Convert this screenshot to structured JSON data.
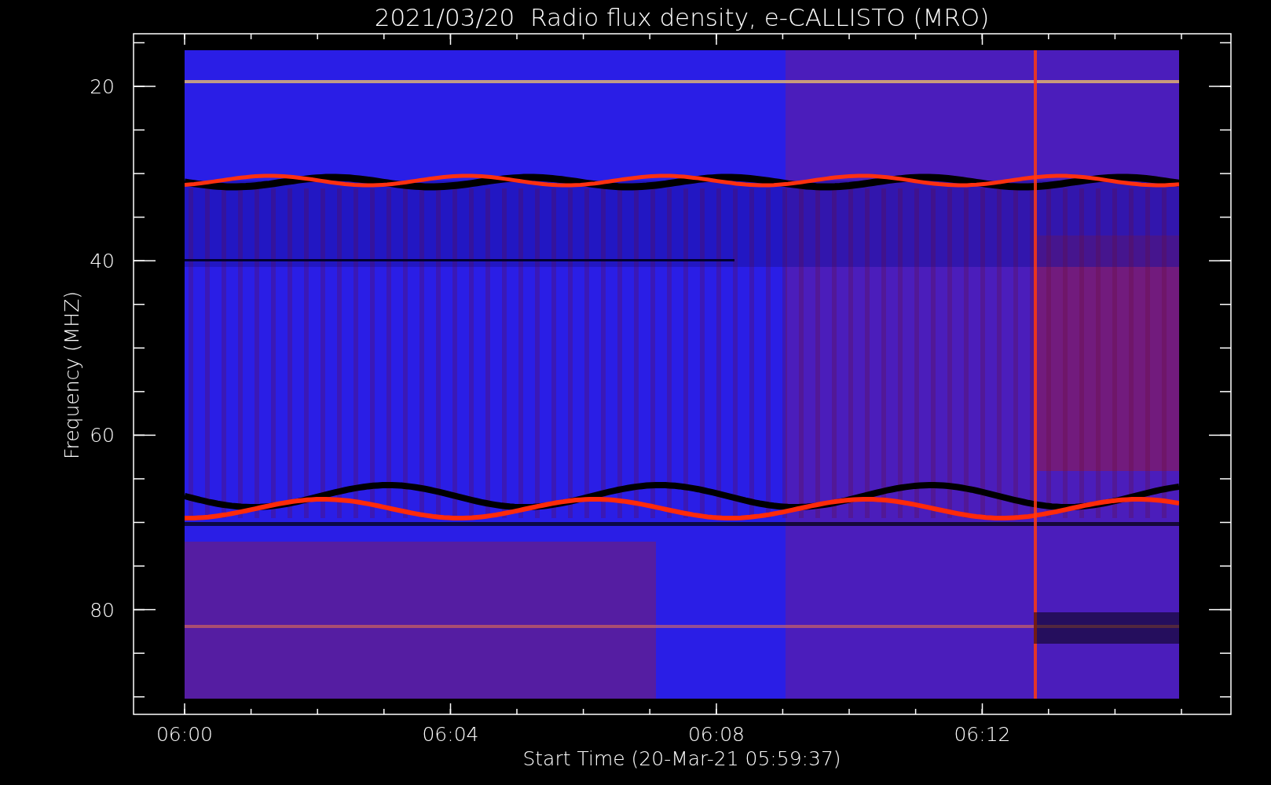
{
  "title": "2021/03/20  Radio flux density, e-CALLISTO (MRO)",
  "xlabel": "Start Time (20-Mar-21 05:59:37)",
  "ylabel": "Frequency (MHZ)",
  "xticks": [
    "06:00",
    "06:04",
    "06:08",
    "06:12"
  ],
  "yticks": [
    "20",
    "40",
    "60",
    "80"
  ]
}
